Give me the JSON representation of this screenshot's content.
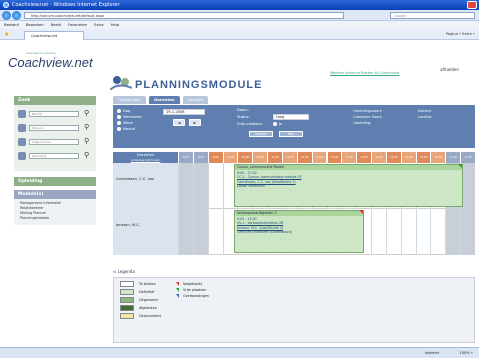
{
  "browser": {
    "title": "Coachview.net - Windows Internet Explorer",
    "url": "http://secure.coachview.net/default.aspx",
    "search_placeholder": "Google",
    "menu": [
      "Bestand",
      "Bewerken",
      "Beeld",
      "Favorieten",
      "Extra",
      "Help"
    ],
    "tab_label": "Coachview.net",
    "tools_label": "Pagina • Extra •",
    "status_zone": "Internet",
    "status_zoom": "100% •"
  },
  "app": {
    "logo": "Coachview.net",
    "logo_tagline": "onderwijs en opleiding",
    "module_title": "PLANNINGSMODULE",
    "welcome_link": "Welkom Johanna Bakker bij Coachview",
    "logout": "afmelden"
  },
  "sidebar": {
    "search_title": "Zoek",
    "search_fields": [
      "Bedrijf",
      "Persoon",
      "Volgnummer",
      "Opleiding"
    ],
    "training_title": "Opleiding",
    "modules_title": "Module(s)",
    "module_items": [
      "Management informatie",
      "Relatiebeheer",
      "Mailing Planner",
      "Planningsmodule"
    ]
  },
  "tabs": [
    "Opleidingen",
    "Docenten",
    "Locaties"
  ],
  "active_tab": "Docenten",
  "filter": {
    "view_options": [
      "Dag",
      "Werkweek",
      "Week",
      "Maand"
    ],
    "date": "19-1-2008",
    "prev": "◄",
    "next": "►",
    "name_label": "Naam:",
    "status_label": "Status:",
    "status_value": "Leeg",
    "free_label": "Vrije plaatsen:",
    "free_value": "Ja",
    "search_button": "Zoeken",
    "clear_button": "Wis",
    "right_labels": [
      "Opleidingssoort:",
      "Categorie Soort:",
      "Opleiding:"
    ],
    "right_labels_2": [
      "Docent:",
      "Locatie:"
    ]
  },
  "grid": {
    "header_name": "Docenten",
    "header_sub": "(volledige lijst tonen)",
    "slots": [
      "8:00",
      "8:30",
      "9:00",
      "9:30",
      "10:00",
      "10:30",
      "11:00",
      "11:30",
      "12:00",
      "12:30",
      "13:00",
      "13:30",
      "14:00",
      "14:30",
      "15:00",
      "15:30",
      "16:00",
      "16:30",
      "17:00",
      "17:30"
    ],
    "rows": [
      {
        "name": "Cornelissen, C.C. van",
        "appt_header": "Cursus, communicatie Positie",
        "appt_lines": [
          "9:00 - 17:00",
          "CC-1 - Cursus, communicatie module 05",
          "Cornelissen, C.C. van (Kwalificatie 1)",
          "Lokaal Veldhoven"
        ]
      },
      {
        "name": "Janssen, M.C.",
        "appt_header": "Verkoopsvaardigheden 3",
        "appt_lines": [
          "9:00 - 17:00",
          "VV-1 - Verkooptechnieken 2B",
          "Janssen, M.C. (Kwalificatie 3)",
          "Centrum Eindhoven (Oudenbosch)"
        ]
      }
    ]
  },
  "legend": {
    "title": "Legenda",
    "statuses": [
      {
        "label": "Te starten",
        "color": "#ffffff"
      },
      {
        "label": "Definitief",
        "color": "#cde6c5"
      },
      {
        "label": "Uitgevoerd",
        "color": "#8fb47c"
      },
      {
        "label": "Afgesloten",
        "color": "#3f6f35"
      },
      {
        "label": "Geannuleerd",
        "color": "#f2e7a0"
      }
    ],
    "markers": [
      {
        "label": "Volgeboekt",
        "color": "#d32"
      },
      {
        "label": "Vrije plaatsen",
        "color": "#2c9d3a"
      },
      {
        "label": "Overboekingen",
        "color": "#3f6fc0"
      }
    ]
  },
  "colors": {
    "accent_blue": "#5f7fb0",
    "slot_morning": "#e08a5a",
    "slot_day": "#e8a57a"
  }
}
